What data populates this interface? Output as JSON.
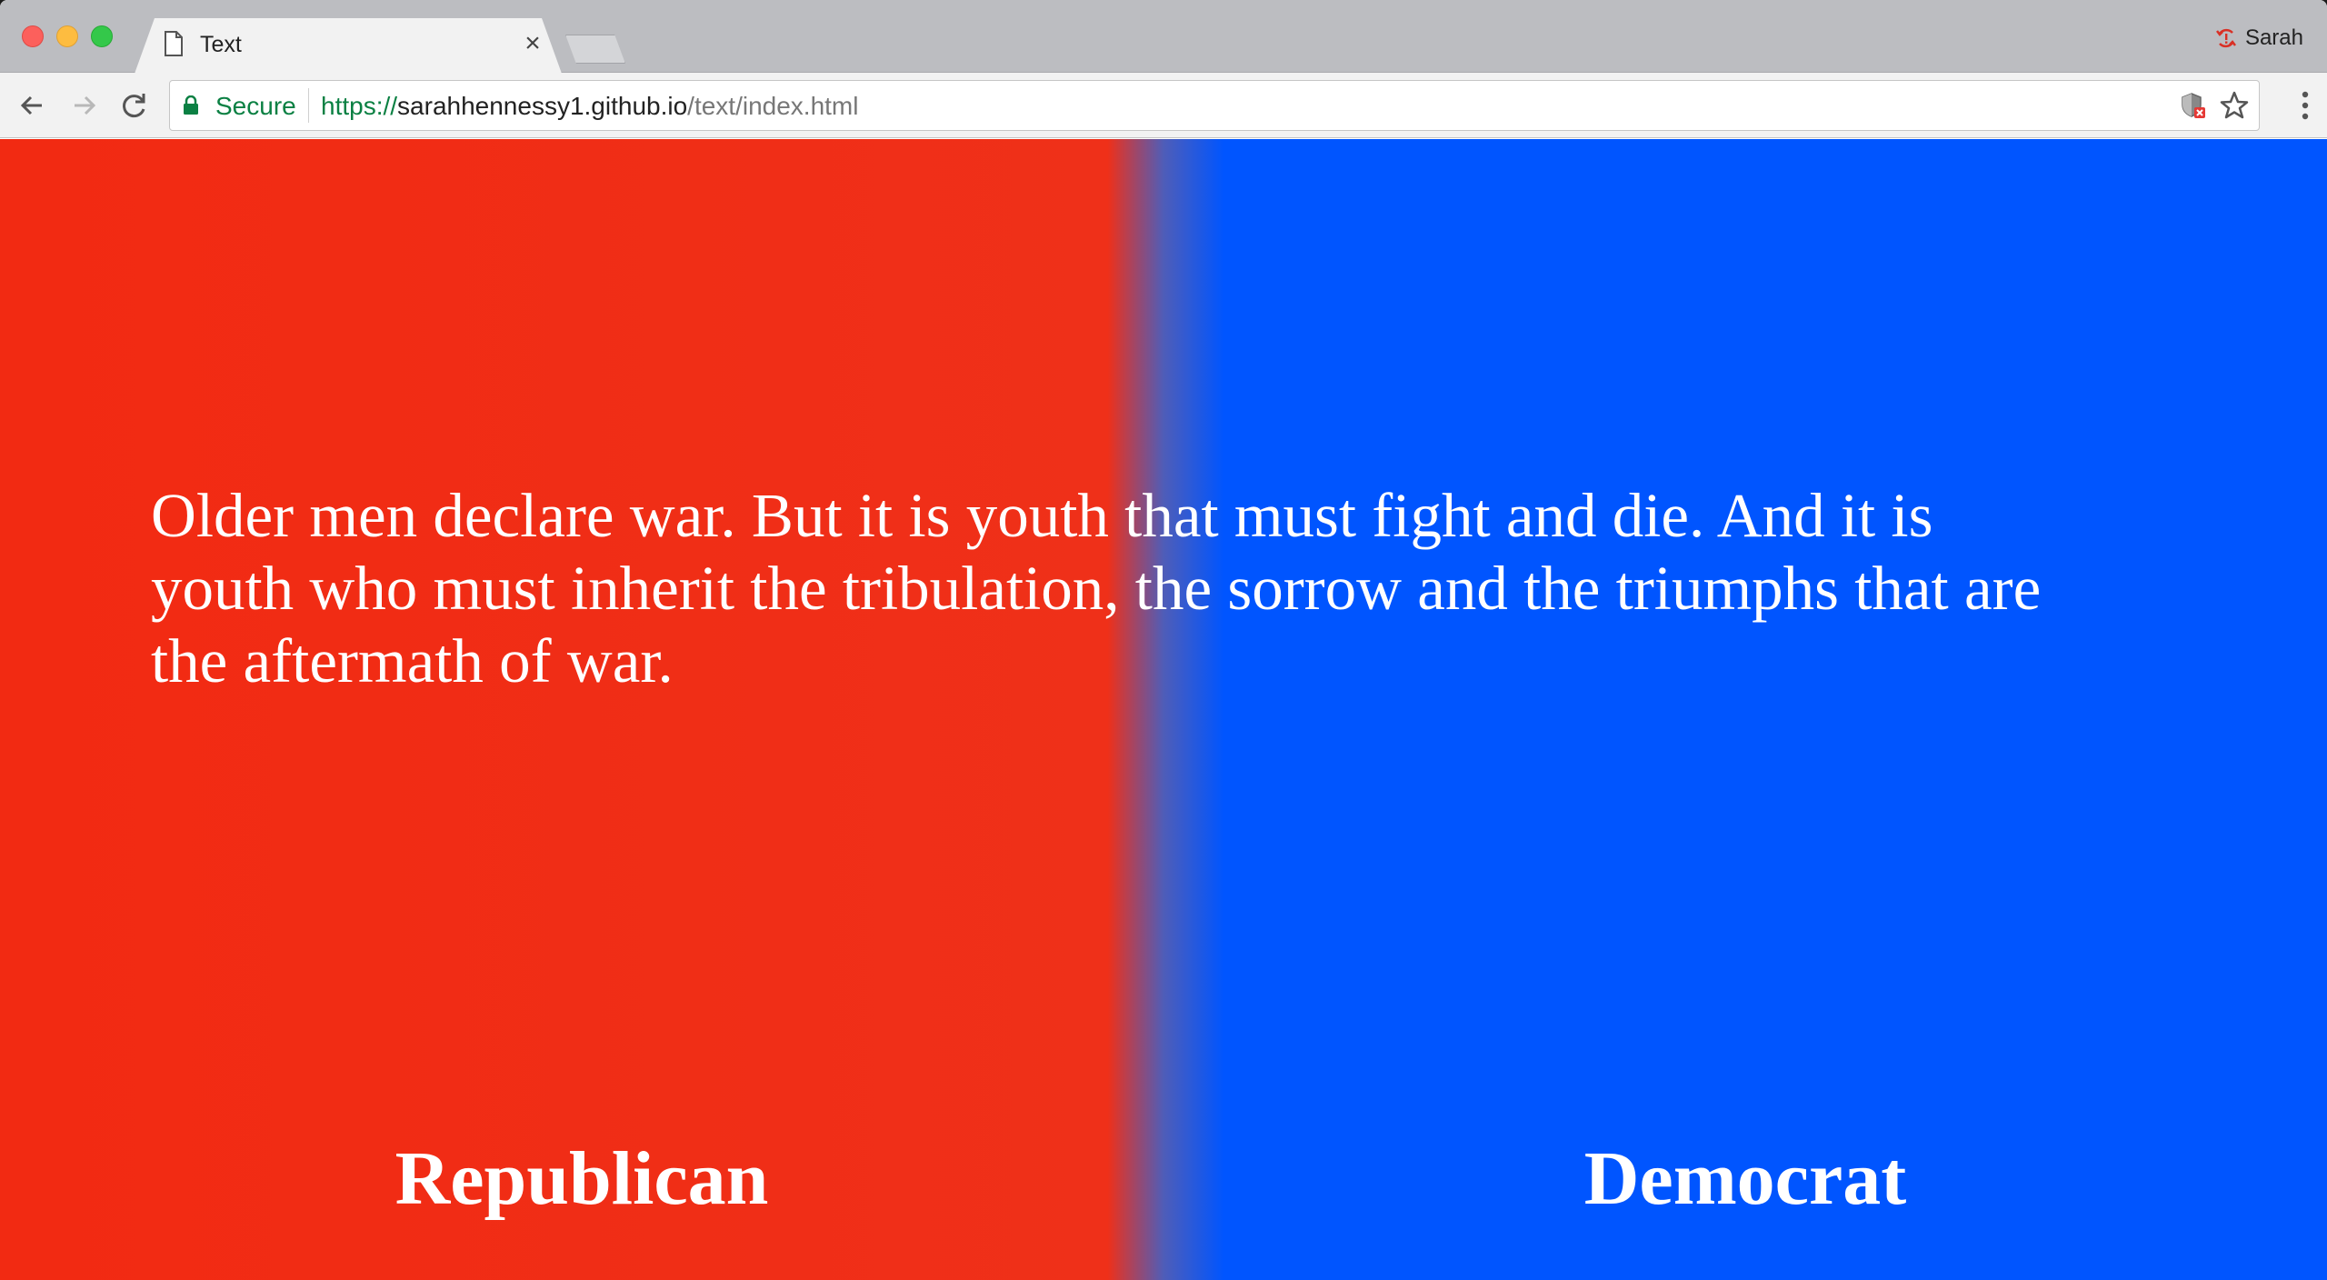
{
  "browser": {
    "tab": {
      "title": "Text"
    },
    "profile": {
      "name": "Sarah",
      "icon": "sync-error-icon"
    },
    "address_bar": {
      "secure_label": "Secure",
      "url_scheme": "https://",
      "url_host": "sarahhennessy1.github.io",
      "url_path": "/text/index.html"
    },
    "icons": {
      "tab": "document-icon",
      "close": "×",
      "back": "back-arrow-icon",
      "forward": "forward-arrow-icon",
      "reload": "reload-icon",
      "lock": "lock-icon",
      "extension": "shield-blocked-icon",
      "bookmark": "star-icon",
      "menu": "vertical-dots-icon"
    }
  },
  "page": {
    "quote": "Older men declare war. But it is youth that must fight and die. And it is youth who must inherit the tribulation, the sorrow and the triumphs that are the aftermath of war.",
    "left_label": "Republican",
    "right_label": "Democrat",
    "colors": {
      "left": "#f22a12",
      "right": "#0055ff",
      "text": "#ffffff"
    }
  }
}
